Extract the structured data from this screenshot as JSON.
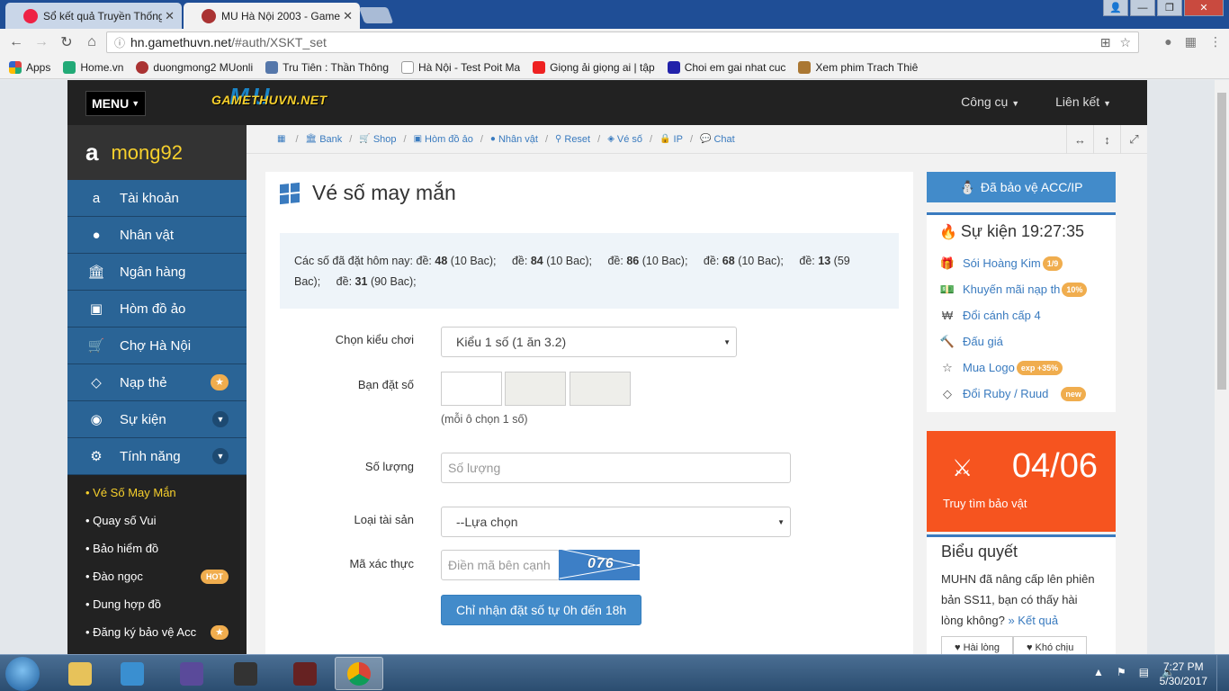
{
  "browser": {
    "tabs": [
      {
        "title": "Sổ kết quả Truyền Thống",
        "active": false
      },
      {
        "title": "MU Hà Nội 2003 - Game",
        "active": true
      }
    ],
    "url_host": "hn.gamethuvn.net",
    "url_rest": "/#auth/XSKT_set",
    "bookmarks": [
      {
        "label": "Apps",
        "color": "#d44"
      },
      {
        "label": "Home.vn",
        "color": "#2a7"
      },
      {
        "label": "duongmong2 MUonli",
        "color": "#a33"
      },
      {
        "label": "Tru Tiên : Thần Thông",
        "color": "#57a"
      },
      {
        "label": "Hà Nội - Test Poit Ma",
        "color": "#999"
      },
      {
        "label": "Giọng ải giọng ai | tập",
        "color": "#e22"
      },
      {
        "label": "Choi em gai nhat cuc",
        "color": "#22a"
      },
      {
        "label": "Xem phim Trach Thiê",
        "color": "#a73"
      }
    ]
  },
  "site": {
    "menu_label": "MENU",
    "logo_text": "GAMETHUVN.NET",
    "logo_mu": "MU",
    "topnav": [
      {
        "label": "Công cụ"
      },
      {
        "label": "Liên kết"
      }
    ]
  },
  "sidebar": {
    "username": "mong92",
    "items": [
      {
        "label": "Tài khoản",
        "icon": "amazon-icon"
      },
      {
        "label": "Nhân vật",
        "icon": "user-icon"
      },
      {
        "label": "Ngân hàng",
        "icon": "bank-icon"
      },
      {
        "label": "Hòm đồ ảo",
        "icon": "briefcase-icon"
      },
      {
        "label": "Chợ Hà Nội",
        "icon": "cart-icon"
      },
      {
        "label": "Nạp thẻ",
        "icon": "diamond-icon"
      },
      {
        "label": "Sự kiện",
        "icon": "android-icon"
      },
      {
        "label": "Tính năng",
        "icon": "cogs-icon"
      }
    ],
    "submenu": [
      {
        "label": "Vé Số May Mắn",
        "active": true,
        "badge": ""
      },
      {
        "label": "Quay số Vui",
        "active": false,
        "badge": ""
      },
      {
        "label": "Bảo hiểm đồ",
        "active": false,
        "badge": ""
      },
      {
        "label": "Đào ngọc",
        "active": false,
        "badge": "HOT"
      },
      {
        "label": "Dung hợp đồ",
        "active": false,
        "badge": ""
      },
      {
        "label": "Đăng ký bảo vệ Acc",
        "active": false,
        "badge": "★"
      }
    ]
  },
  "breadcrumbs": [
    {
      "label": "",
      "icon": "calendar-icon"
    },
    {
      "label": "Bank",
      "icon": "bank-icon"
    },
    {
      "label": "Shop",
      "icon": "cart-icon"
    },
    {
      "label": "Hòm đồ ảo",
      "icon": "briefcase-icon"
    },
    {
      "label": "Nhân vật",
      "icon": "user-icon"
    },
    {
      "label": "Reset",
      "icon": "reset-icon"
    },
    {
      "label": "Vé số",
      "icon": "ticket-icon"
    },
    {
      "label": "IP",
      "icon": "lock-icon"
    },
    {
      "label": "Chat",
      "icon": "chat-icon"
    }
  ],
  "main": {
    "title": "Vé số may mắn",
    "notice_prefix": "Các số đã đặt hôm nay:",
    "bets": [
      {
        "label": "đề:",
        "number": "48",
        "amount": "(10 Bac);"
      },
      {
        "label": "đề:",
        "number": "84",
        "amount": "(10 Bac);"
      },
      {
        "label": "đề:",
        "number": "86",
        "amount": "(10 Bac);"
      },
      {
        "label": "đề:",
        "number": "68",
        "amount": "(10 Bac);"
      },
      {
        "label": "đề:",
        "number": "13",
        "amount": "(59 Bac);"
      },
      {
        "label": "đề:",
        "number": "31",
        "amount": "(90 Bac);"
      }
    ],
    "form": {
      "play_type_label": "Chọn kiểu chơi",
      "play_type_value": "Kiểu 1 số (1 ăn 3.2)",
      "number_label": "Bạn đặt số",
      "number_hint": "(mỗi ô chọn 1 số)",
      "quantity_label": "Số lượng",
      "quantity_placeholder": "Số lượng",
      "asset_label": "Loại tài sản",
      "asset_value": "--Lựa chọn",
      "captcha_label": "Mã xác thực",
      "captcha_placeholder": "Điền mã bên cạnh",
      "captcha_text": "076",
      "submit_label": "Chỉ nhận đặt số tự 0h đến 18h"
    }
  },
  "right": {
    "protect_label": "Đã bảo vệ ACC/IP",
    "events_title": "Sự kiện 19:27:35",
    "events": [
      {
        "label": "Sói Hoàng Kim",
        "badge": "1/9",
        "icon": "gift-icon"
      },
      {
        "label": "Khuyến mãi nạp th",
        "badge": "10%",
        "icon": "money-icon"
      },
      {
        "label": "Đổi cánh cấp 4",
        "badge": "",
        "icon": "won-icon"
      },
      {
        "label": "Đấu giá",
        "badge": "",
        "icon": "gavel-icon"
      },
      {
        "label": "Mua Logo",
        "badge": "exp +35%",
        "icon": "star-icon"
      },
      {
        "label": "Đổi Ruby / Ruud",
        "badge": "new",
        "icon": "diamond-icon"
      }
    ],
    "countdown_date": "04/06",
    "countdown_label": "Truy tìm bảo vật",
    "poll_title": "Biểu quyết",
    "poll_question": "MUHN đã nâng cấp lên phiên bản SS11, bạn có thấy hài lòng không?",
    "poll_link": "» Kết quả",
    "poll_yes": "Hài lòng",
    "poll_no": "Khó chịu"
  },
  "taskbar": {
    "time": "7:27 PM",
    "date": "5/30/2017"
  }
}
